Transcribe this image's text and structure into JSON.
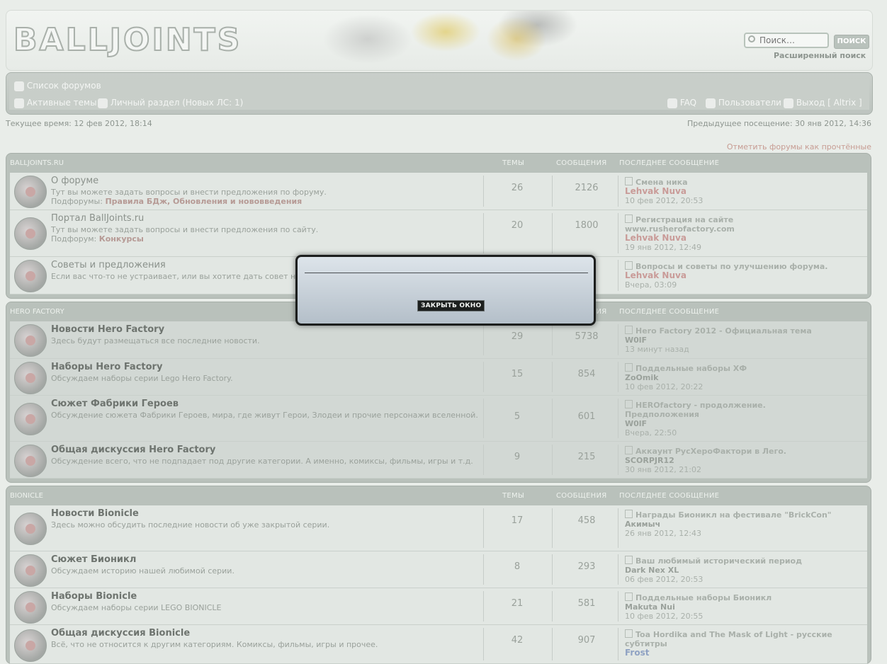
{
  "header": {
    "logo": "BALLJOINTS",
    "search_placeholder": "Поиск…",
    "search_button": "ПОИСК",
    "advanced_search": "Расширенный поиск"
  },
  "nav": {
    "forum_list": "Список форумов",
    "active_topics": "Активные темы",
    "private": "Личный раздел (Новых ЛС: 1)",
    "faq": "FAQ",
    "users": "Пользователи",
    "logout": "Выход [ Altrix ]",
    "time_now": "Текущее время: 12 фев 2012, 18:14",
    "time_prev": "Предыдущее посещение: 30 янв 2012, 14:36",
    "mark_read": "Отметить форумы как прочтённые"
  },
  "columns": {
    "topics": "ТЕМЫ",
    "posts": "СООБЩЕНИЯ",
    "last": "ПОСЛЕДНЕЕ СООБЩЕНИЕ"
  },
  "categories": [
    {
      "name": "BALLJOINTS.RU",
      "forums": [
        {
          "title": "О форуме",
          "desc": "Тут вы можете задать вопросы и внести предложения по форуму.",
          "sub_label": "Подфорумы:",
          "subs": "Правила БДж, Обновления и нововведения",
          "topics": "26",
          "posts": "2126",
          "last_title": "Смена ника",
          "last_user": "Lehvak Nuva",
          "last_date": "10 фев 2012, 20:53"
        },
        {
          "title": "Портал BallJoints.ru",
          "desc": "Тут вы можете задать вопросы и внести предложения по сайту.",
          "sub_label": "Подфорум:",
          "subs": "Конкурсы",
          "topics": "20",
          "posts": "1800",
          "last_title": "Регистрация на сайте www.rusherofactory.com",
          "last_user": "Lehvak Nuva",
          "last_date": "19 янв 2012, 12:49"
        },
        {
          "title": "Советы и предложения",
          "desc": "Если вас что-то не устраивает, или вы хотите дать совет н",
          "topics": "",
          "posts": "",
          "last_title": "Вопросы и советы по улучшению форума.",
          "last_user": "Lehvak Nuva",
          "last_date": "Вчера, 03:09"
        }
      ]
    },
    {
      "name": "HERO FACTORY",
      "forums": [
        {
          "title": "Новости Hero Factory",
          "desc": "Здесь будут размещаться все последние новости.",
          "topics": "29",
          "posts": "5738",
          "last_title": "Hero Factory 2012 - Официальная тема",
          "last_user": "W0lF",
          "last_date": "13 минут назад"
        },
        {
          "title": "Наборы Hero Factory",
          "desc": "Обсуждаем наборы серии Lego Hero Factory.",
          "topics": "15",
          "posts": "854",
          "last_title": "Поддельные наборы ХФ",
          "last_user": "ZoOmik",
          "last_date": "10 фев 2012, 20:22"
        },
        {
          "title": "Сюжет Фабрики Героев",
          "desc": "Обсуждение сюжета Фабрики Героев, мира, где живут Герои, Злодеи и прочие персонажи вселенной.",
          "topics": "5",
          "posts": "601",
          "last_title": "HEROfactory - продолжение. Предположения",
          "last_user": "W0lF",
          "last_date": "Вчера, 22:50"
        },
        {
          "title": "Общая дискуссия Hero Factory",
          "desc": "Обсуждение всего, что не подпадает под другие категории. А именно, комиксы, фильмы, игры и т.д.",
          "topics": "9",
          "posts": "215",
          "last_title": "Аккаунт РусХероФактори в Лего.",
          "last_user": "SCORPJR12",
          "last_date": "30 янв 2012, 21:02"
        }
      ]
    },
    {
      "name": "BIONICLE",
      "forums": [
        {
          "title": "Новости Bionicle",
          "desc": "Здесь можно обсудить последние новости об уже закрытой серии.",
          "topics": "17",
          "posts": "458",
          "last_title": "Награды Бионикл на фестивале \"BrickCon\"",
          "last_user": "Акимыч",
          "last_date": "26 янв 2012, 12:43"
        },
        {
          "title": "Сюжет Бионикл",
          "desc": "Обсуждаем историю нашей любимой серии.",
          "topics": "8",
          "posts": "293",
          "last_title": "Ваш любимый исторический период",
          "last_user": "Dark Nex XL",
          "last_date": "06 фев 2012, 20:53"
        },
        {
          "title": "Наборы Bionicle",
          "desc": "Обсуждаем наборы серии LEGO BIONICLE",
          "topics": "21",
          "posts": "581",
          "last_title": "Поддельные наборы Бионикл",
          "last_user": "Makuta Nui",
          "last_date": "10 фев 2012, 20:55"
        },
        {
          "title": "Общая дискуссия Bionicle",
          "desc": "Всё, что не относится к другим категориям. Комиксы, фильмы, игры и прочее.",
          "topics": "42",
          "posts": "907",
          "last_title": "Toa Hordika and The Mask of Light - русские субтитры",
          "last_user": "Frost",
          "last_date": ""
        }
      ]
    }
  ],
  "modal": {
    "close": "ЗАКРЫТЬ ОКНО"
  }
}
